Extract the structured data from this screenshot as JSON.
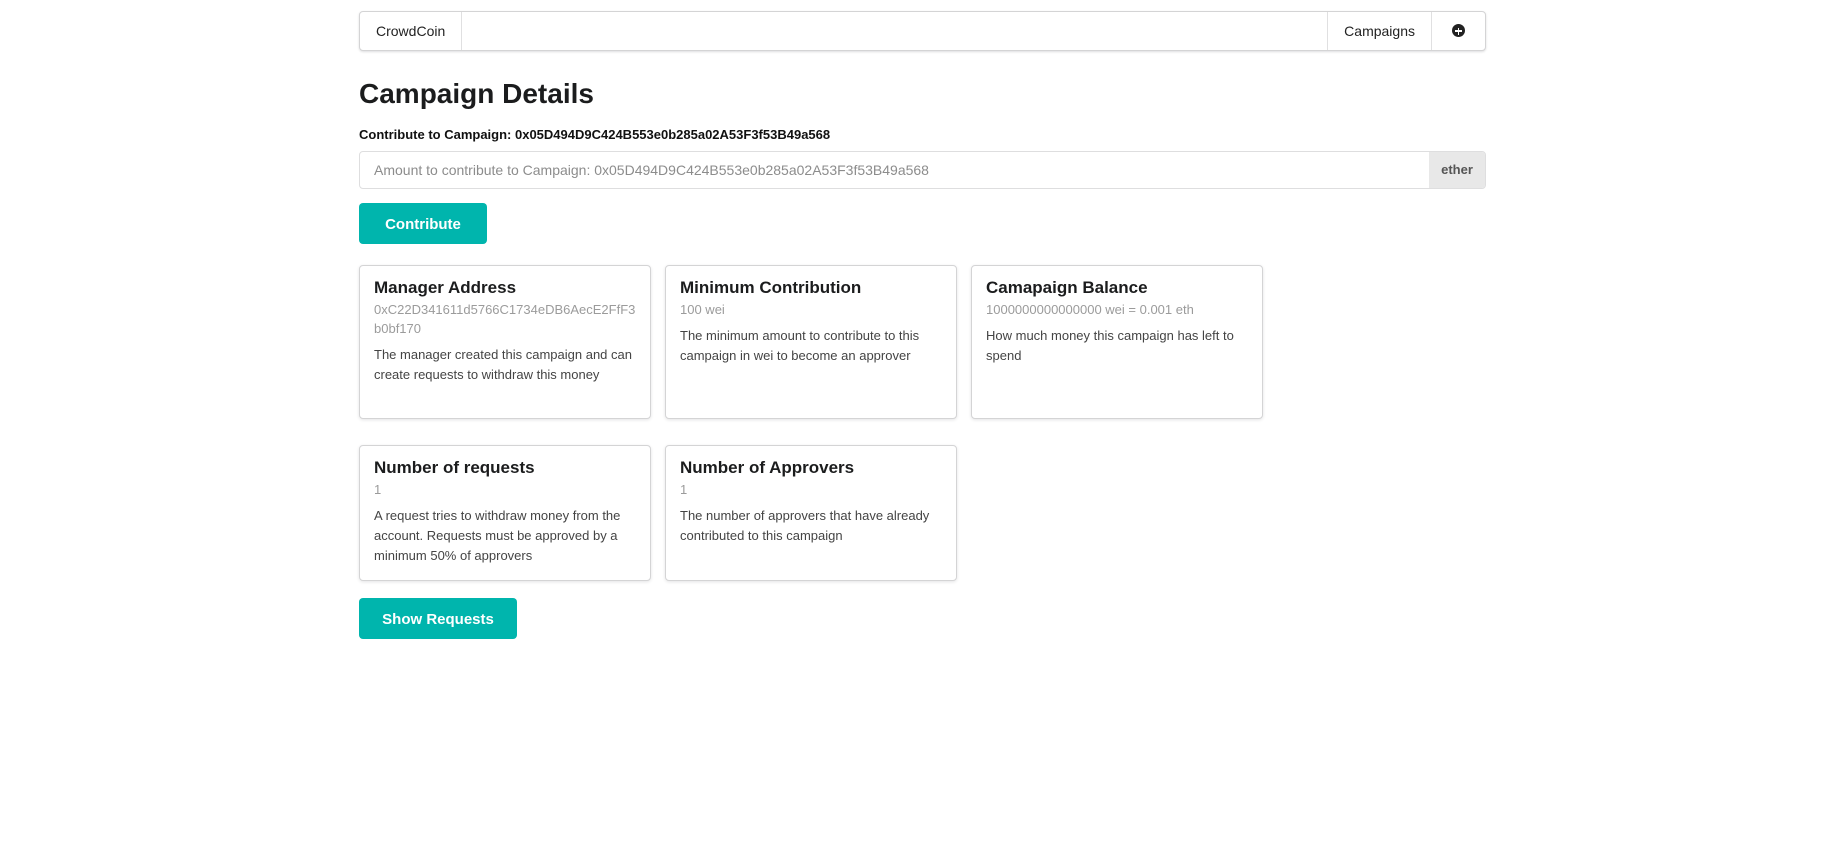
{
  "nav": {
    "brand": "CrowdCoin",
    "campaigns": "Campaigns",
    "add_icon": "plus-circle-icon"
  },
  "page": {
    "title": "Campaign Details"
  },
  "contribute": {
    "label": "Contribute to Campaign: 0x05D494D9C424B553e0b285a02A53F3f53B49a568",
    "placeholder": "Amount to contribute to Campaign: 0x05D494D9C424B553e0b285a02A53F3f53B49a568",
    "unit": "ether",
    "button": "Contribute"
  },
  "cards": [
    {
      "header": "Manager Address",
      "meta": "0xC22D341611d5766C1734eDB6AecE2FfF3b0bf170",
      "description": "The manager created this campaign and can create requests to withdraw this money"
    },
    {
      "header": "Minimum Contribution",
      "meta": "100 wei",
      "description": "The minimum amount to contribute to this campaign in wei to become an approver"
    },
    {
      "header": "Camapaign Balance",
      "meta": "1000000000000000 wei = 0.001 eth",
      "description": "How much money this campaign has left to spend"
    },
    {
      "header": "Number of requests",
      "meta": "1",
      "description": "A request tries to withdraw money from the account. Requests must be approved by a minimum 50% of approvers"
    },
    {
      "header": "Number of Approvers",
      "meta": "1",
      "description": "The number of approvers that have already contributed to this campaign"
    }
  ],
  "actions": {
    "show_requests": "Show Requests"
  },
  "colors": {
    "accent": "#00b5ad"
  }
}
